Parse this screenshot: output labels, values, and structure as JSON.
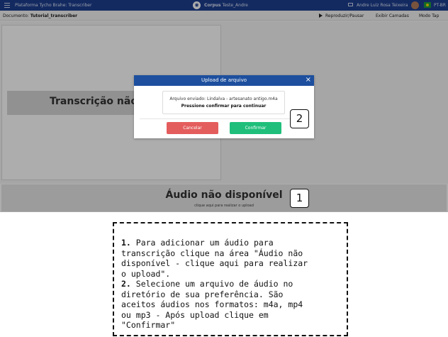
{
  "topbar": {
    "brand": "Plataforma Tycho Brahe: Transcriber",
    "corpus_label": "Corpus",
    "corpus_value": "Teste_Andre",
    "user": "Andre Luiz Rosa Teixeira",
    "lang": "PT-BR",
    "bg_color": "#1d3f8f"
  },
  "subbar": {
    "doc_label": "Documento:",
    "doc_value": "Tutorial_transcriber",
    "play_label": "Reproduzir/Pausar",
    "layers_label": "Exibir Camadas",
    "mode_label": "Modo Tap"
  },
  "transcription": {
    "placeholder": "Transcrição não"
  },
  "audio": {
    "title": "Áudio não disponível",
    "subtitle": "clique aqui para realizar o upload"
  },
  "modal": {
    "title": "Upload de arquivo",
    "close": "×",
    "file_line": "Arquivo enviado: Lindalva - artesanato antigo.m4a",
    "instruction": "Pressione confirmar para continuar",
    "cancel_label": "Cancelar",
    "confirm_label": "Confirmar",
    "cancel_color": "#e45d5d",
    "confirm_color": "#1fbf7b"
  },
  "callouts": {
    "one": "1",
    "two": "2"
  },
  "instructions": {
    "step1_num": "1.",
    "step1_text": " Para adicionar um áudio para\ntranscrição clique na área \"Áudio não\ndisponível - clique aqui para realizar\no upload\".",
    "step2_num": "2.",
    "step2_text": " Selecione um arquivo de áudio no\ndiretório de sua preferência. São\naceitos áudios nos formatos: m4a, mp4\nou mp3 - Após upload clique em\n\"Confirmar\""
  }
}
